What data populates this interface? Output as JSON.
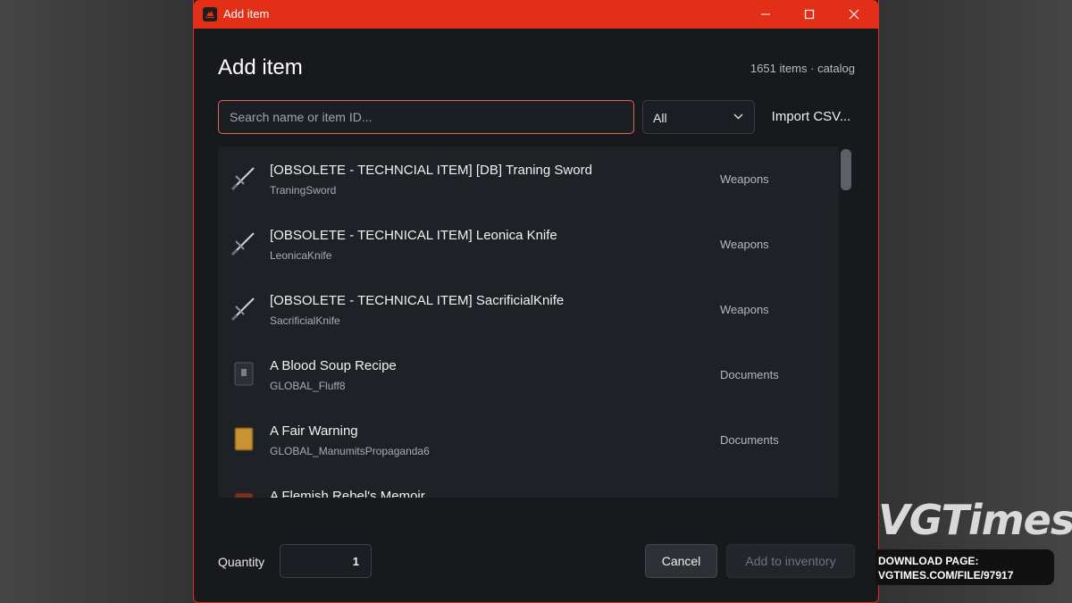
{
  "window": {
    "title": "Add item"
  },
  "dialog": {
    "heading": "Add item",
    "count_text": "1651 items · catalog",
    "search_placeholder": "Search name or item ID...",
    "filter_value": "All",
    "import_label": "Import CSV...",
    "items": [
      {
        "name": "[OBSOLETE - TECHNCIAL ITEM] [DB] Traning Sword",
        "id": "TraningSword",
        "category": "Weapons",
        "icon": "sword-icon"
      },
      {
        "name": "[OBSOLETE - TECHNICAL ITEM] Leonica Knife",
        "id": "LeonicaKnife",
        "category": "Weapons",
        "icon": "sword-icon"
      },
      {
        "name": "[OBSOLETE - TECHNICAL ITEM] SacrificialKnife",
        "id": "SacrificialKnife",
        "category": "Weapons",
        "icon": "sword-icon"
      },
      {
        "name": "A Blood Soup Recipe",
        "id": "GLOBAL_Fluff8",
        "category": "Documents",
        "icon": "dark-book-icon"
      },
      {
        "name": "A Fair Warning",
        "id": "GLOBAL_ManumitsPropaganda6",
        "category": "Documents",
        "icon": "yellow-book-icon"
      },
      {
        "name": "A Flemish Rebel's Memoir",
        "id": "",
        "category": "",
        "icon": "red-book-icon"
      }
    ],
    "quantity_label": "Quantity",
    "quantity_value": "1",
    "cancel_label": "Cancel",
    "add_label": "Add to inventory"
  },
  "watermark": {
    "brand": "VGTimes",
    "line1": "DOWNLOAD PAGE:",
    "line2": "VGTIMES.COM/FILE/97917"
  },
  "colors": {
    "accent": "#e32f18",
    "window_bg": "#17191c",
    "list_bg": "#1e2227"
  }
}
